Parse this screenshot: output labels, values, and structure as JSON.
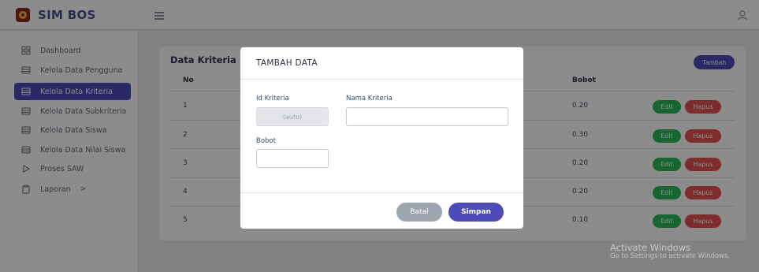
{
  "app": {
    "brand": "SIM BOS"
  },
  "sidebar": {
    "items": [
      {
        "label": "Dashboard",
        "icon": "grid-icon"
      },
      {
        "label": "Kelola Data Pengguna",
        "icon": "table-icon"
      },
      {
        "label": "Kelola Data Kriteria",
        "icon": "table-icon",
        "active": true
      },
      {
        "label": "Kelola Data Subkriteria",
        "icon": "table-icon"
      },
      {
        "label": "Kelola Data Siswa",
        "icon": "table-icon"
      },
      {
        "label": "Kelola Data Nilai Siswa",
        "icon": "table-icon"
      },
      {
        "label": "Proses SAW",
        "icon": "play-icon"
      },
      {
        "label": "Laporan",
        "icon": "clipboard-icon",
        "chevron": ">"
      }
    ]
  },
  "card": {
    "title": "Data Kriteria",
    "add_label": "Tambah",
    "columns": {
      "no": "No",
      "bobot": "Bobot"
    },
    "rows": [
      {
        "no": "1",
        "bobot": "0.20"
      },
      {
        "no": "2",
        "bobot": "0.30"
      },
      {
        "no": "3",
        "bobot": "0.20"
      },
      {
        "no": "4",
        "bobot": "0.20"
      },
      {
        "no": "5",
        "bobot": "0.10"
      }
    ],
    "edit_label": "Edit",
    "delete_label": "Hapus"
  },
  "modal": {
    "title": "TAMBAH DATA",
    "id_label": "Id Kriteria",
    "id_value": "(auto)",
    "name_label": "Nama Kriteria",
    "name_value": "",
    "bobot_label": "Bobot",
    "bobot_value": "",
    "cancel_label": "Batal",
    "save_label": "Simpan"
  },
  "watermark": {
    "line1": "Activate Windows",
    "line2": "Go to Settings to activate Windows."
  },
  "colors": {
    "primary": "#4d4bb8",
    "success": "#2eb85c",
    "danger": "#e55353",
    "secondary": "#9da5b1"
  }
}
